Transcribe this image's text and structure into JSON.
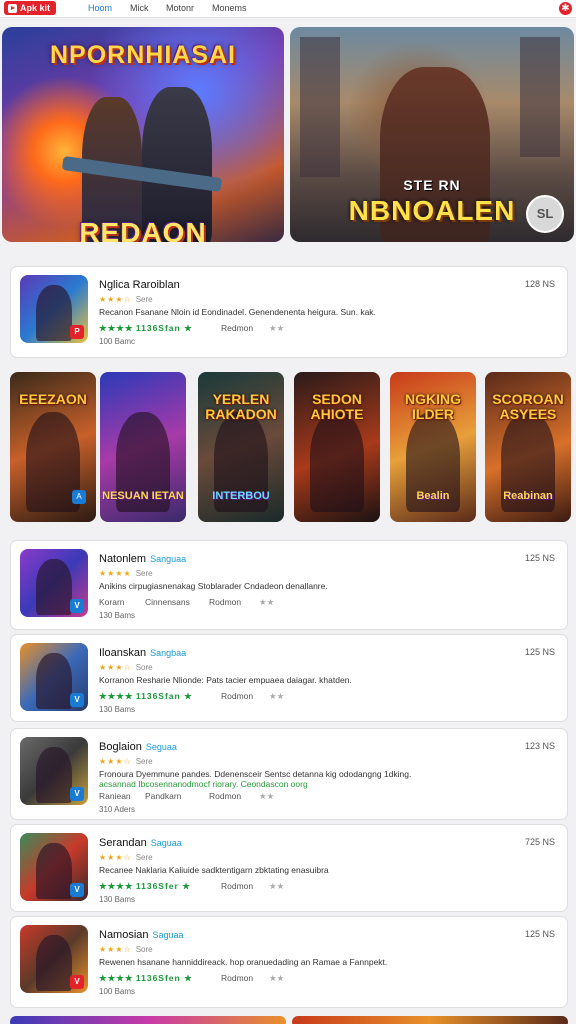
{
  "header": {
    "logo_text": "Apk kit",
    "nav": [
      "Hoom",
      "Mick",
      "Motonr",
      "Monems"
    ]
  },
  "banners": [
    {
      "title": "NPORNHIASAI",
      "subtitle": "REDAON"
    },
    {
      "title": "STE RN",
      "subtitle": "NBNOALEN",
      "badge": "SL"
    }
  ],
  "featured": {
    "title": "Nglica Raroiblan",
    "size": "128 NS",
    "rating_text": "Sere",
    "description": "Recanon Fsanane Nloin id Eondinadel. Genendenenta heigura. Sun. kak.",
    "green_stars": "★★★★",
    "green_text": "1136Sfan ★",
    "meta_tag": "Redmon",
    "installs": "100 Bamc",
    "icon_badge": "P"
  },
  "tiles": [
    {
      "top": "EEEZAON",
      "bottom": ""
    },
    {
      "top": "",
      "bottom": "NESUAN IETAN"
    },
    {
      "top": "YERLEN RAKADON",
      "bottom": "INTERBOU"
    },
    {
      "top": "SEDON AHIOTE",
      "bottom": ""
    },
    {
      "top": "NGKING ILDER",
      "bottom": "Bealin"
    },
    {
      "top": "SCOROAN ASYEES",
      "bottom": "Reabinan"
    }
  ],
  "apps": [
    {
      "title": "Natonlem",
      "sub": "Sanguaa",
      "size": "125 NS",
      "rating_text": "Sere",
      "desc": "Anikins cirpugiasnenakag Stoblarader Cndadeon denallanre.",
      "desc2": "",
      "meta": "Korarn",
      "meta2": "Cinnensans",
      "meta3": "Rodmon",
      "installs": "130 Bams",
      "badge": "V",
      "green": false
    },
    {
      "title": "Iloanskan",
      "sub": "Sangbaa",
      "size": "125 NS",
      "rating_text": "Sore",
      "desc": "Korranon Resharie Nlionde: Pats tacier empuaea daiagar. khatden.",
      "desc2": "",
      "meta": "1136Sfan ★",
      "meta2": "Rodmon",
      "meta3": "",
      "installs": "130 Bams",
      "badge": "V",
      "green": true
    },
    {
      "title": "Boglaion",
      "sub": "Seguaa",
      "size": "123 NS",
      "rating_text": "Sere",
      "desc": "Fronoura Dyemmune pandes. Ddenensceir Sentsc detanna kig ododangng 1dking.",
      "desc2": "acsannad Ibcosennanodmocf riorary. Ceondascon oorg",
      "meta": "Raniean",
      "meta2": "Pandkarn",
      "meta3": "Rodmon",
      "installs": "310 Aders",
      "badge": "V",
      "green": false
    },
    {
      "title": "Serandan",
      "sub": "Saguaa",
      "size": "725 NS",
      "rating_text": "Sere",
      "desc": "Recanee Naklaria Kaliuide sadktentigarn zbktating enasuibra",
      "desc2": "",
      "meta": "1136Sfer ★",
      "meta2": "Rodmon",
      "meta3": "",
      "installs": "130 Bams",
      "badge": "V",
      "green": true
    },
    {
      "title": "Namosian",
      "sub": "Saguaa",
      "size": "125 NS",
      "rating_text": "Sore",
      "desc": "Rewenen hsanane hanniddireack. hop oranuedading an Ramae a Fannpekt.",
      "desc2": "",
      "meta": "1136Sfen ★",
      "meta2": "Rodmon",
      "meta3": "",
      "installs": "100 Bams",
      "badge": "V",
      "green": true
    }
  ],
  "colors": {
    "brand": "#e32229",
    "accent": "#1a7bd5",
    "green": "#1a9a3a",
    "star": "#f0a818"
  }
}
